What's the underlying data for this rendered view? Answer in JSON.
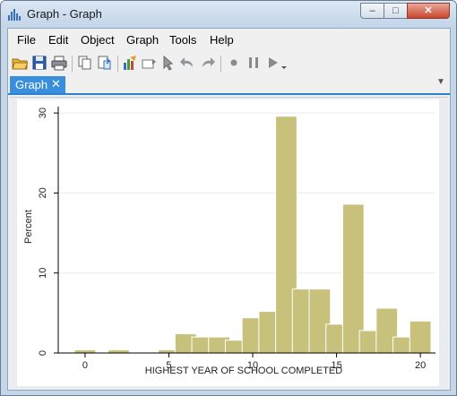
{
  "window": {
    "title": "Graph - Graph",
    "controls": {
      "minimize": "–",
      "maximize": "□",
      "close": "✕"
    }
  },
  "menubar": {
    "items": [
      "File",
      "Edit",
      "Object",
      "Graph",
      "Tools",
      "Help"
    ]
  },
  "toolbar": {
    "icons": [
      "open-icon",
      "save-icon",
      "print-icon",
      "copy-icon",
      "paste-icon",
      "graph-editor-icon",
      "rename-icon",
      "pointer-icon",
      "undo-icon",
      "redo-icon",
      "record-icon",
      "pause-icon",
      "play-icon"
    ]
  },
  "tabs": [
    {
      "label": "Graph",
      "close": "✕"
    }
  ],
  "tab_dropdown": "▼",
  "colors": {
    "bar_fill": "#c8c17c",
    "bar_stroke": "#ffffff",
    "tab_active": "#3a8fdc",
    "plot_bg": "#ffffff",
    "graph_bg": "#e9edf1"
  },
  "chart_data": {
    "type": "bar",
    "x": [
      0,
      2,
      5,
      6,
      7,
      8,
      9,
      10,
      11,
      12,
      13,
      14,
      15,
      16,
      17,
      18,
      19,
      20
    ],
    "values": [
      0.4,
      0.4,
      0.4,
      2.4,
      2.0,
      2.0,
      1.6,
      4.4,
      5.2,
      29.6,
      8.0,
      8.0,
      3.6,
      18.6,
      2.8,
      5.6,
      2.0,
      4.0
    ],
    "bin_width": 1.27,
    "xlabel": "HIGHEST YEAR OF SCHOOL COMPLETED",
    "ylabel": "Percent",
    "xticks": [
      0,
      5,
      10,
      15,
      20
    ],
    "yticks": [
      0,
      10,
      20,
      30
    ],
    "xlim": [
      -1.6,
      20.9
    ],
    "ylim": [
      0,
      30.8
    ],
    "grid": true
  }
}
